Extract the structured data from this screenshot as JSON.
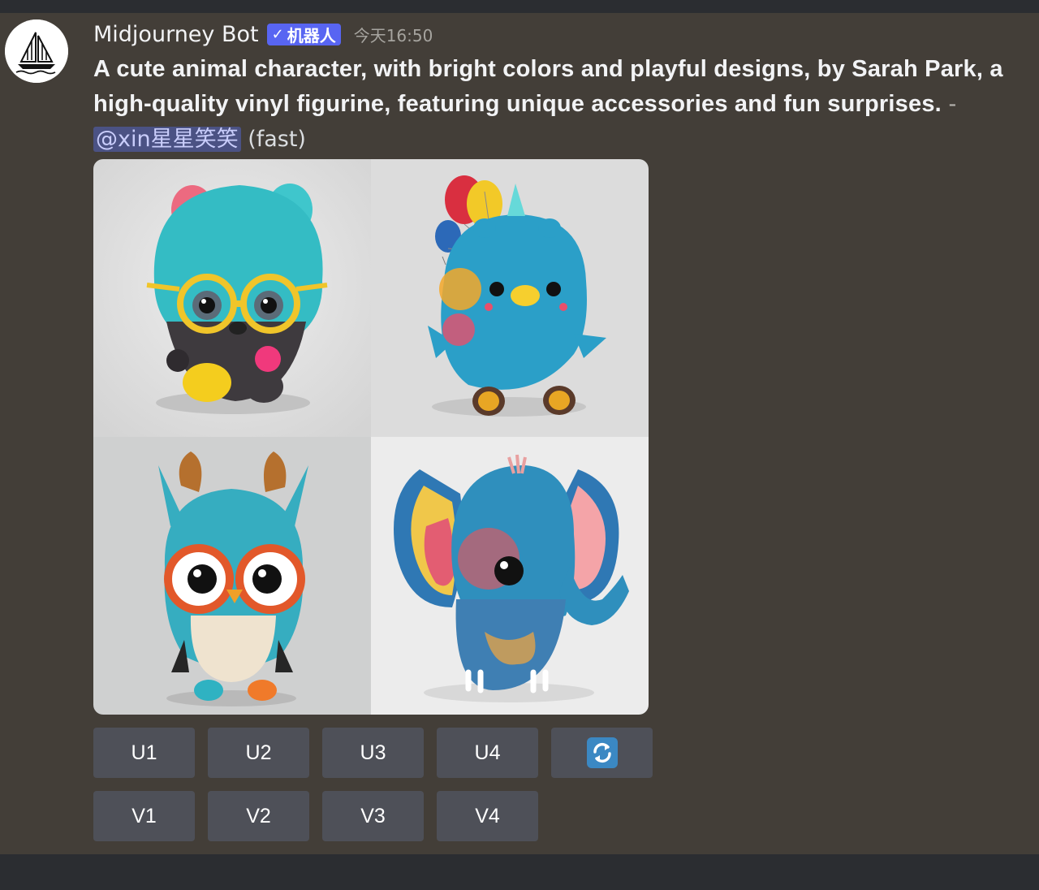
{
  "message": {
    "author": "Midjourney Bot",
    "badge": "机器人",
    "badge_check": "✓",
    "timestamp": "今天16:50",
    "prompt_text": "A cute animal character, with bright colors and playful designs, by Sarah Park, a high-quality vinyl figurine, featuring unique accessories and fun surprises.",
    "separator": " - ",
    "mention": "@xin星星笑笑",
    "speed": "(fast)"
  },
  "image_grid": {
    "tiles": [
      {
        "subject": "teal bear figurine with yellow glasses"
      },
      {
        "subject": "blue unicorn figurine with balloons"
      },
      {
        "subject": "teal owl figurine with orange glasses"
      },
      {
        "subject": "colorful patterned elephant figurine"
      }
    ]
  },
  "buttons": {
    "upscale": [
      "U1",
      "U2",
      "U3",
      "U4"
    ],
    "reroll_icon": "refresh-icon",
    "variation": [
      "V1",
      "V2",
      "V3",
      "V4"
    ]
  },
  "colors": {
    "background": "#433e38",
    "frame": "#2b2d31",
    "button": "#4e5058",
    "badge": "#5865f2",
    "mention_bg": "#4b5284",
    "refresh_icon": "#3b88c3"
  }
}
